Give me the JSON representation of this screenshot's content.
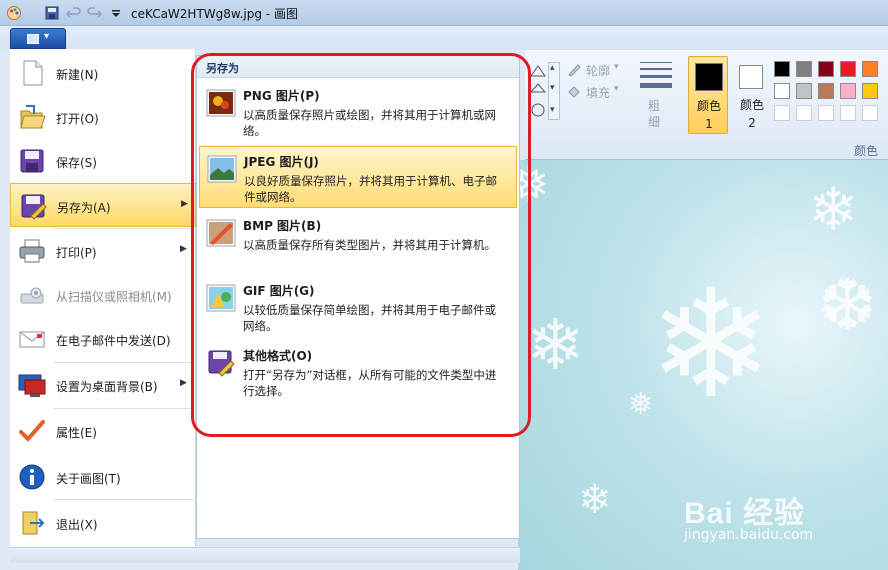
{
  "window": {
    "title": "ceKCaW2HTWg8w.jpg - 画图"
  },
  "left_menu": {
    "items": [
      {
        "label": "新建(N)",
        "icon": "new-document-icon",
        "submenu": false,
        "disabled": false,
        "active": false
      },
      {
        "label": "打开(O)",
        "icon": "open-folder-icon",
        "submenu": false,
        "disabled": false,
        "active": false
      },
      {
        "label": "保存(S)",
        "icon": "floppy-save-icon",
        "submenu": false,
        "disabled": false,
        "active": false
      },
      {
        "label": "另存为(A)",
        "icon": "save-as-icon",
        "submenu": true,
        "disabled": false,
        "active": true
      },
      {
        "label": "打印(P)",
        "icon": "printer-icon",
        "submenu": true,
        "disabled": false,
        "active": false
      },
      {
        "label": "从扫描仪或照相机(M)",
        "icon": "scanner-icon",
        "submenu": false,
        "disabled": true,
        "active": false
      },
      {
        "label": "在电子邮件中发送(D)",
        "icon": "email-icon",
        "submenu": false,
        "disabled": false,
        "active": false
      },
      {
        "label": "设置为桌面背景(B)",
        "icon": "desktop-background-icon",
        "submenu": true,
        "disabled": false,
        "active": false
      },
      {
        "label": "属性(E)",
        "icon": "checkmark-icon",
        "submenu": false,
        "disabled": false,
        "active": false
      },
      {
        "label": "关于画图(T)",
        "icon": "info-icon",
        "submenu": false,
        "disabled": false,
        "active": false
      },
      {
        "label": "退出(X)",
        "icon": "exit-icon",
        "submenu": false,
        "disabled": false,
        "active": false
      }
    ]
  },
  "save_as_menu": {
    "title": "另存为",
    "items": [
      {
        "title": "PNG 图片(P)",
        "desc": "以高质量保存照片或绘图，并将其用于计算机或网络。",
        "icon": "png-image-icon",
        "active": false
      },
      {
        "title": "JPEG 图片(J)",
        "desc": "以良好质量保存照片，并将其用于计算机、电子邮件或网络。",
        "icon": "jpeg-image-icon",
        "active": true
      },
      {
        "title": "BMP 图片(B)",
        "desc": "以高质量保存所有类型图片，并将其用于计算机。",
        "icon": "bmp-image-icon",
        "active": false
      },
      {
        "title": "GIF 图片(G)",
        "desc": "以较低质量保存简单绘图，并将其用于电子邮件或网络。",
        "icon": "gif-image-icon",
        "active": false
      },
      {
        "title": "其他格式(O)",
        "desc": "打开“另存为”对话框，从所有可能的文件类型中进行选择。",
        "icon": "other-formats-icon",
        "active": false
      }
    ]
  },
  "ribbon": {
    "outline_label": "轮廓",
    "fill_label": "填充",
    "size_label": "粗细",
    "color1_label": "颜色 1",
    "color2_label": "颜色 2",
    "colors_group_label": "颜色",
    "palette": [
      "#000000",
      "#7f7f7f",
      "#880015",
      "#ed1c24",
      "#ff7f27",
      "#ffffff",
      "#c3c3c3",
      "#b97a57",
      "#ffaec9",
      "#ffc90e"
    ],
    "color1": "#000000",
    "color2": "#ffffff"
  },
  "watermark": {
    "logo": "Bai 经验",
    "url": "jingyan.baidu.com"
  }
}
